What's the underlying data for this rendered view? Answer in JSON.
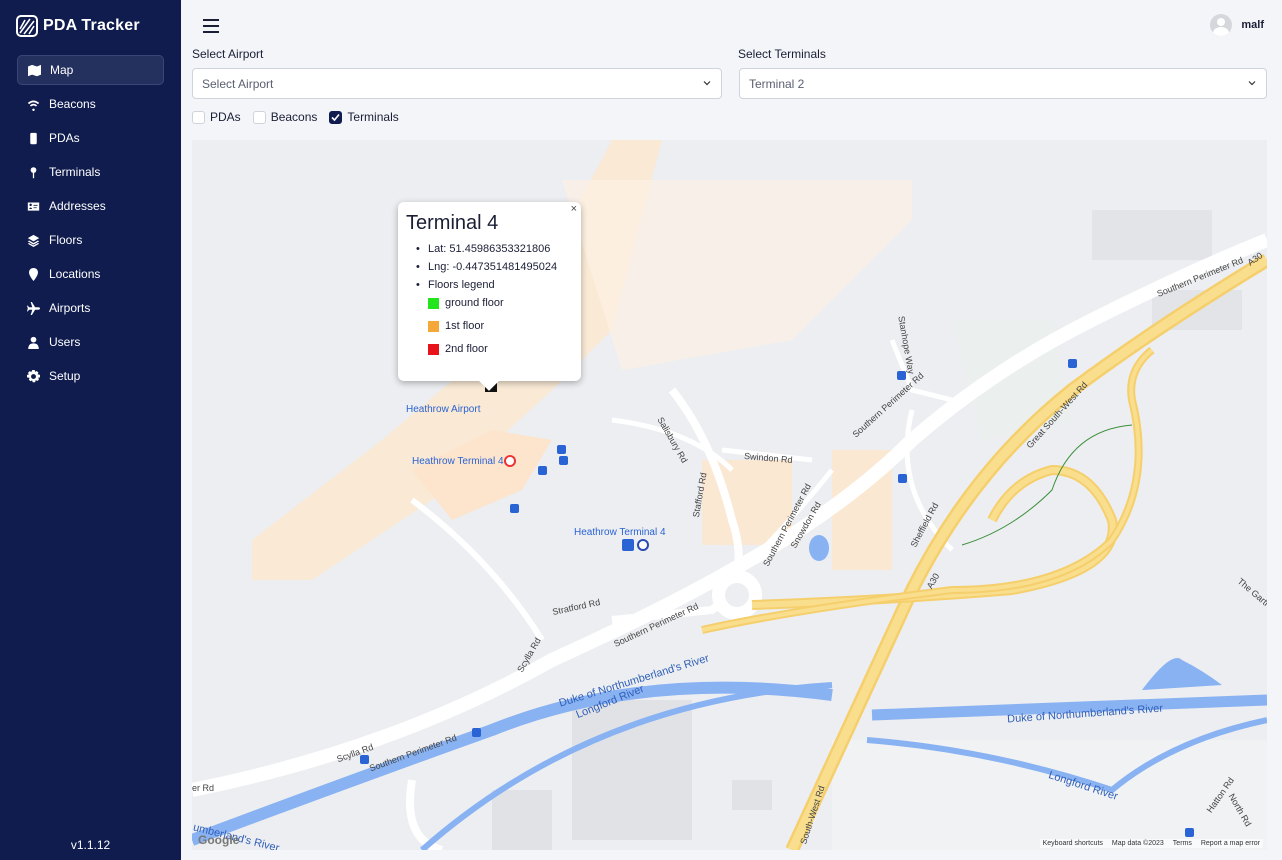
{
  "brand": {
    "name": "PDA Tracker"
  },
  "sidebar": {
    "items": [
      {
        "label": "Map",
        "icon": "map-icon",
        "active": true
      },
      {
        "label": "Beacons",
        "icon": "wifi-icon"
      },
      {
        "label": "PDAs",
        "icon": "device-icon"
      },
      {
        "label": "Terminals",
        "icon": "pin-icon"
      },
      {
        "label": "Addresses",
        "icon": "address-card-icon"
      },
      {
        "label": "Floors",
        "icon": "layers-icon"
      },
      {
        "label": "Locations",
        "icon": "location-icon"
      },
      {
        "label": "Airports",
        "icon": "plane-icon"
      },
      {
        "label": "Users",
        "icon": "user-icon"
      },
      {
        "label": "Setup",
        "icon": "gear-icon"
      }
    ],
    "version": "v1.1.12"
  },
  "header": {
    "username": "malf"
  },
  "filters": {
    "airport_label": "Select Airport",
    "airport_value": "Select Airport",
    "terminals_label": "Select Terminals",
    "terminals_value": "Terminal 2",
    "checkboxes": [
      {
        "label": "PDAs",
        "checked": false
      },
      {
        "label": "Beacons",
        "checked": false
      },
      {
        "label": "Terminals",
        "checked": true
      }
    ]
  },
  "popup": {
    "title": "Terminal 4",
    "lat": "Lat: 51.45986353321806",
    "lng": "Lng: -0.447351481495024",
    "legend_title": "Floors legend",
    "legend": [
      {
        "label": "ground floor",
        "color": "#22e51c"
      },
      {
        "label": "1st floor",
        "color": "#f5a83a"
      },
      {
        "label": "2nd floor",
        "color": "#e8121a"
      }
    ]
  },
  "map": {
    "labels": {
      "heathrow_airport": "Heathrow Airport",
      "heathrow_t4_underground": "Heathrow Terminal 4",
      "heathrow_t4_station": "Heathrow Terminal 4",
      "southern_perimeter_1": "Southern Perimeter Rd",
      "southern_perimeter_2": "Southern Perimeter Rd",
      "southern_perimeter_3": "Southern Perimeter Rd",
      "southern_perimeter_4": "Southern Perimeter Rd",
      "southern_perimeter_5": "Southern Perimeter Rd",
      "southern_perimeter_6": "Southern Perimeter Rd",
      "great_south_west": "Great South-West Rd",
      "south_west_rd": "South-West Rd",
      "a30_1": "A30",
      "a30_2": "A30",
      "swindon": "Swindon Rd",
      "salisbury": "Salisbury Rd",
      "stafford": "Stafford Rd",
      "stratford": "Stratford Rd",
      "snowdon": "Snowdon Rd",
      "sheffield": "Sheffield Rd",
      "scylla_1": "Scylla Rd",
      "scylla_2": "Scylla Rd",
      "stanhope": "Stanhope Way",
      "river_duke_1": "Duke of Northumberland's River",
      "river_duke_2": "Duke of Northumberland's River",
      "river_longford_1": "Longford River",
      "river_longford_2": "Longford River",
      "river_cut": "umberland's River",
      "er_rd": "er Rd",
      "the_garth": "The Garth",
      "hatton_rd": "Hatton Rd",
      "north_rd": "North Rd"
    },
    "attribution": {
      "keyboard": "Keyboard shortcuts",
      "data": "Map data ©2023",
      "terms": "Terms",
      "report": "Report a map error"
    },
    "google": "Google"
  }
}
